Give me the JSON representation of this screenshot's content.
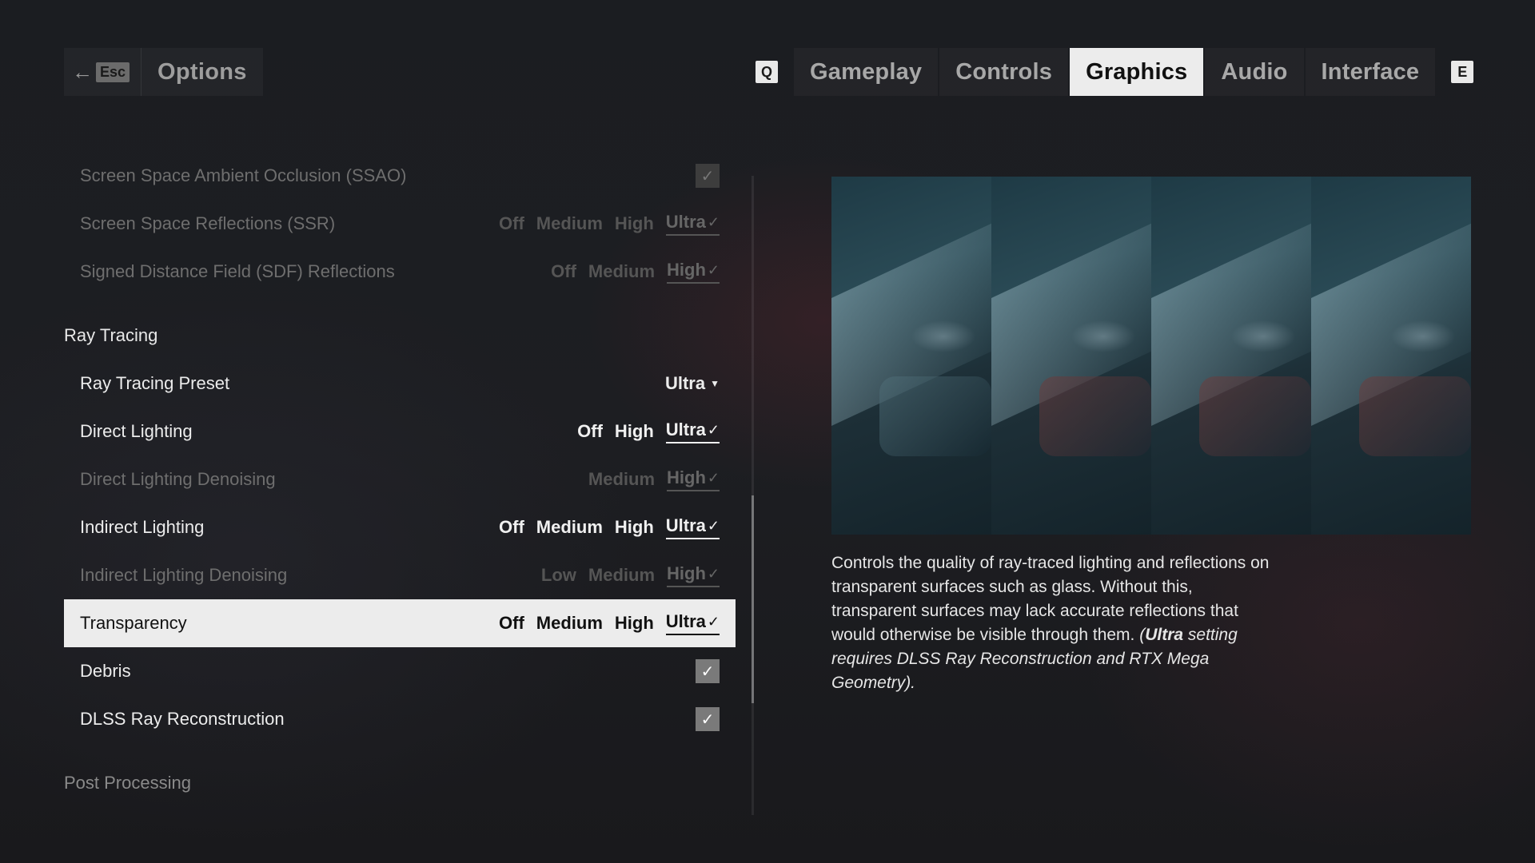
{
  "header": {
    "back_key": "Esc",
    "title": "Options"
  },
  "tabs": {
    "prev_key": "Q",
    "next_key": "E",
    "items": [
      {
        "label": "Gameplay"
      },
      {
        "label": "Controls"
      },
      {
        "label": "Graphics"
      },
      {
        "label": "Audio"
      },
      {
        "label": "Interface"
      }
    ],
    "active": "Graphics"
  },
  "settings": {
    "ssao": {
      "label": "Screen Space Ambient Occlusion (SSAO)"
    },
    "ssr": {
      "label": "Screen Space Reflections (SSR)",
      "options": [
        "Off",
        "Medium",
        "High",
        "Ultra"
      ],
      "selected": "Ultra"
    },
    "sdf": {
      "label": "Signed Distance Field (SDF) Reflections",
      "options": [
        "Off",
        "Medium",
        "High"
      ],
      "selected": "High"
    },
    "ray_tracing_section": "Ray Tracing",
    "rt_preset": {
      "label": "Ray Tracing Preset",
      "value": "Ultra"
    },
    "direct_lighting": {
      "label": "Direct Lighting",
      "options": [
        "Off",
        "High",
        "Ultra"
      ],
      "selected": "Ultra"
    },
    "direct_denoising": {
      "label": "Direct Lighting Denoising",
      "options": [
        "Medium",
        "High"
      ],
      "selected": "High"
    },
    "indirect_lighting": {
      "label": "Indirect Lighting",
      "options": [
        "Off",
        "Medium",
        "High",
        "Ultra"
      ],
      "selected": "Ultra"
    },
    "indirect_denoising": {
      "label": "Indirect Lighting Denoising",
      "options": [
        "Low",
        "Medium",
        "High"
      ],
      "selected": "High"
    },
    "transparency": {
      "label": "Transparency",
      "options": [
        "Off",
        "Medium",
        "High",
        "Ultra"
      ],
      "selected": "Ultra"
    },
    "debris": {
      "label": "Debris"
    },
    "dlss_rr": {
      "label": "DLSS Ray Reconstruction"
    },
    "post_processing_section": "Post Processing"
  },
  "description": {
    "text": "Controls the quality of ray-traced lighting and reflections on transparent surfaces such as glass. Without this, transparent surfaces may lack accurate reflections that would otherwise be visible through them.",
    "note_open": "(",
    "note_bold": "Ultra",
    "note_rest": " setting requires DLSS Ray Reconstruction and RTX Mega Geometry)."
  },
  "icons": {
    "back": "arrow-left-icon",
    "check": "checkmark-icon",
    "caret": "caret-down-icon"
  }
}
